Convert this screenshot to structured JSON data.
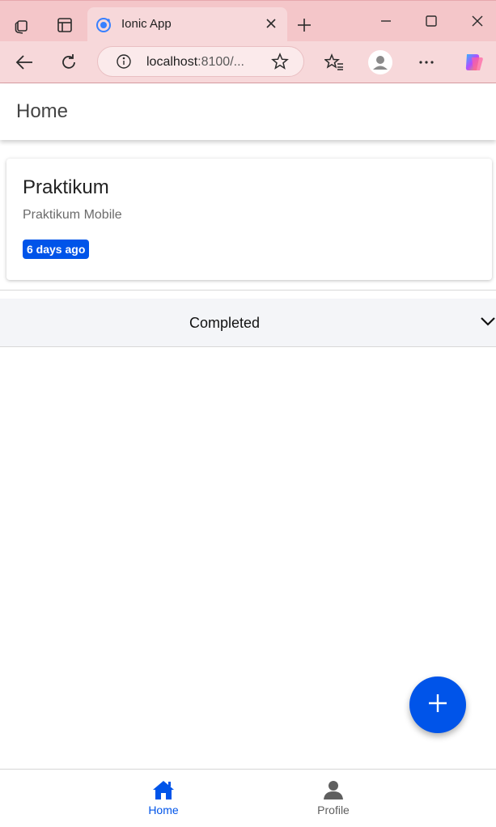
{
  "browser": {
    "tab_title": "Ionic App",
    "url_host": "localhost",
    "url_rest": ":8100/...",
    "icons": [
      "workspaces-icon",
      "vertical-tabs-icon",
      "ionic-favicon-icon",
      "close-tab-icon",
      "new-tab-icon",
      "minimize-icon",
      "maximize-icon",
      "close-window-icon",
      "back-icon",
      "refresh-icon",
      "site-info-icon",
      "favorite-star-icon",
      "favorites-icon",
      "profile-avatar-icon",
      "more-icon",
      "copilot-icon"
    ],
    "colors": {
      "chrome": "#f4c6c9",
      "toolbar": "#f7d8da"
    }
  },
  "header": {
    "title": "Home"
  },
  "task_card": {
    "title": "Praktikum",
    "subtitle": "Praktikum Mobile",
    "badge": "6 days ago"
  },
  "accordion": {
    "label": "Completed",
    "icon": "chevron-down-icon"
  },
  "fab": {
    "icon": "add-icon"
  },
  "tabbar": {
    "items": [
      {
        "label": "Home",
        "icon": "home-icon",
        "selected": true
      },
      {
        "label": "Profile",
        "icon": "person-icon",
        "selected": false
      }
    ]
  },
  "colors": {
    "primary": "#0054e9",
    "accordion_bg": "#f4f5f8"
  }
}
